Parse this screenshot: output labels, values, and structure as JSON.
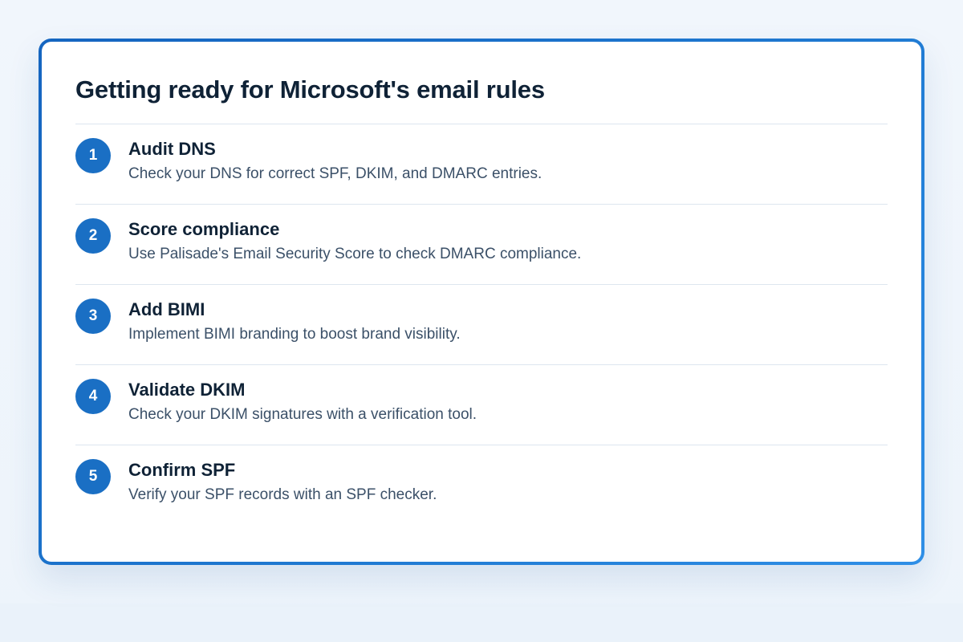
{
  "card": {
    "title": "Getting ready for Microsoft's email rules"
  },
  "steps": [
    {
      "number": "1",
      "title": "Audit DNS",
      "description": "Check your DNS for correct SPF, DKIM, and DMARC entries."
    },
    {
      "number": "2",
      "title": "Score compliance",
      "description": "Use Palisade's Email Security Score to check DMARC compliance."
    },
    {
      "number": "3",
      "title": "Add BIMI",
      "description": "Implement BIMI branding to boost brand visibility."
    },
    {
      "number": "4",
      "title": "Validate DKIM",
      "description": "Check your DKIM signatures with a verification tool."
    },
    {
      "number": "5",
      "title": "Confirm SPF",
      "description": "Verify your SPF records with an SPF checker."
    }
  ],
  "colors": {
    "accent": "#1a6fc4",
    "border_start": "#1565c0",
    "border_end": "#2f8fe6",
    "heading": "#0f2236",
    "body_text": "#3b5068"
  }
}
